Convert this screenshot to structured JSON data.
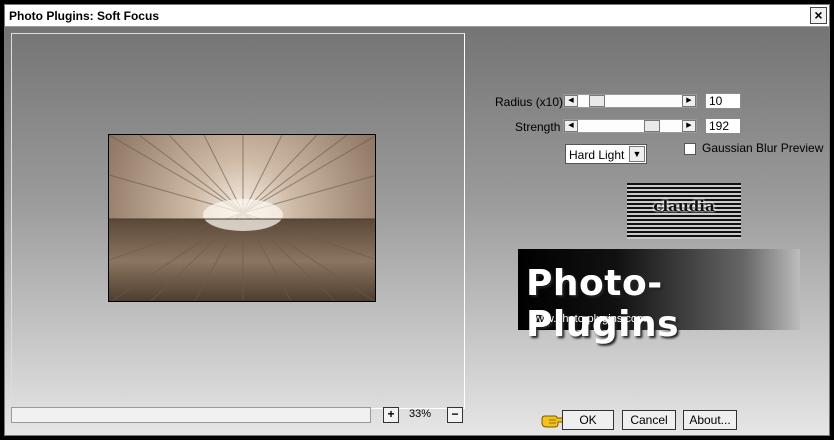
{
  "window": {
    "title": "Photo Plugins: Soft Focus",
    "close_glyph": "×"
  },
  "preview": {
    "zoom_in": "+",
    "zoom_out": "−",
    "zoom_level": "33%"
  },
  "controls": {
    "radius": {
      "label": "Radius (x10)",
      "value": "10",
      "slider_fraction": 0.12
    },
    "strength": {
      "label": "Strength",
      "value": "192",
      "slider_fraction": 0.75
    },
    "blend_mode": {
      "selected": "Hard Light"
    },
    "gaussian_preview": {
      "label": "Gaussian Blur Preview",
      "checked": false
    }
  },
  "branding": {
    "logo_text": "claudia",
    "banner_title": "Photo-Plugins",
    "banner_url": "www.photo-plugins.com"
  },
  "buttons": {
    "ok": "OK",
    "cancel": "Cancel",
    "about": "About..."
  },
  "icons": {
    "close": "close-icon",
    "pointer": "pointing-hand-icon",
    "dropdown": "chevron-down-icon",
    "arrow_left": "arrow-left-icon",
    "arrow_right": "arrow-right-icon"
  },
  "colors": {
    "sepia_light": "#f4ece3",
    "sepia_dark": "#4f4032",
    "frame_top": "#6f6f6f",
    "frame_bottom": "#e6e6e6"
  }
}
